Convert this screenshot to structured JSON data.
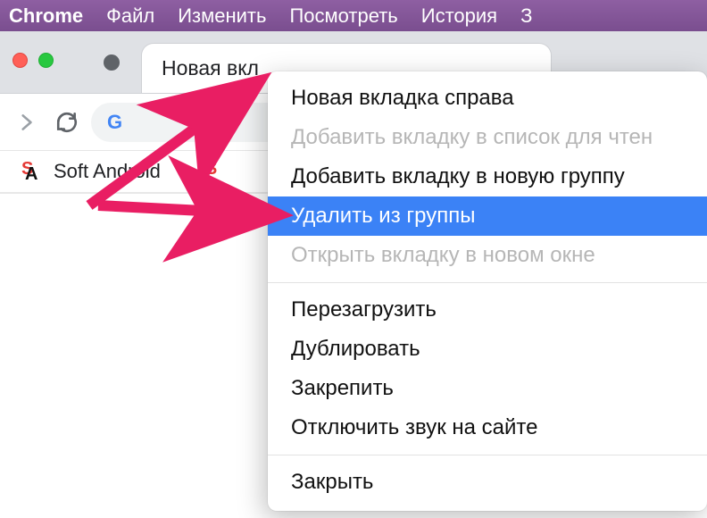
{
  "menubar": {
    "app": "Chrome",
    "items": [
      "Файл",
      "Изменить",
      "Посмотреть",
      "История",
      "З"
    ]
  },
  "tab": {
    "title": "Новая вкл"
  },
  "bookmarks": {
    "items": [
      {
        "label": "Soft Android"
      }
    ]
  },
  "context_menu": {
    "items": [
      {
        "label": "Новая вкладка справа",
        "state": "normal"
      },
      {
        "label": "Добавить вкладку в список для чтен",
        "state": "disabled"
      },
      {
        "label": "Добавить вкладку в новую группу",
        "state": "normal"
      },
      {
        "label": "Удалить из группы",
        "state": "hover"
      },
      {
        "label": "Открыть вкладку в новом окне",
        "state": "disabled"
      },
      {
        "sep": true
      },
      {
        "label": "Перезагрузить",
        "state": "normal"
      },
      {
        "label": "Дублировать",
        "state": "normal"
      },
      {
        "label": "Закрепить",
        "state": "normal"
      },
      {
        "label": "Отключить звук на сайте",
        "state": "normal"
      },
      {
        "sep": true
      },
      {
        "label": "Закрыть",
        "state": "normal"
      }
    ]
  },
  "annotation": {
    "color": "#e91e63"
  }
}
